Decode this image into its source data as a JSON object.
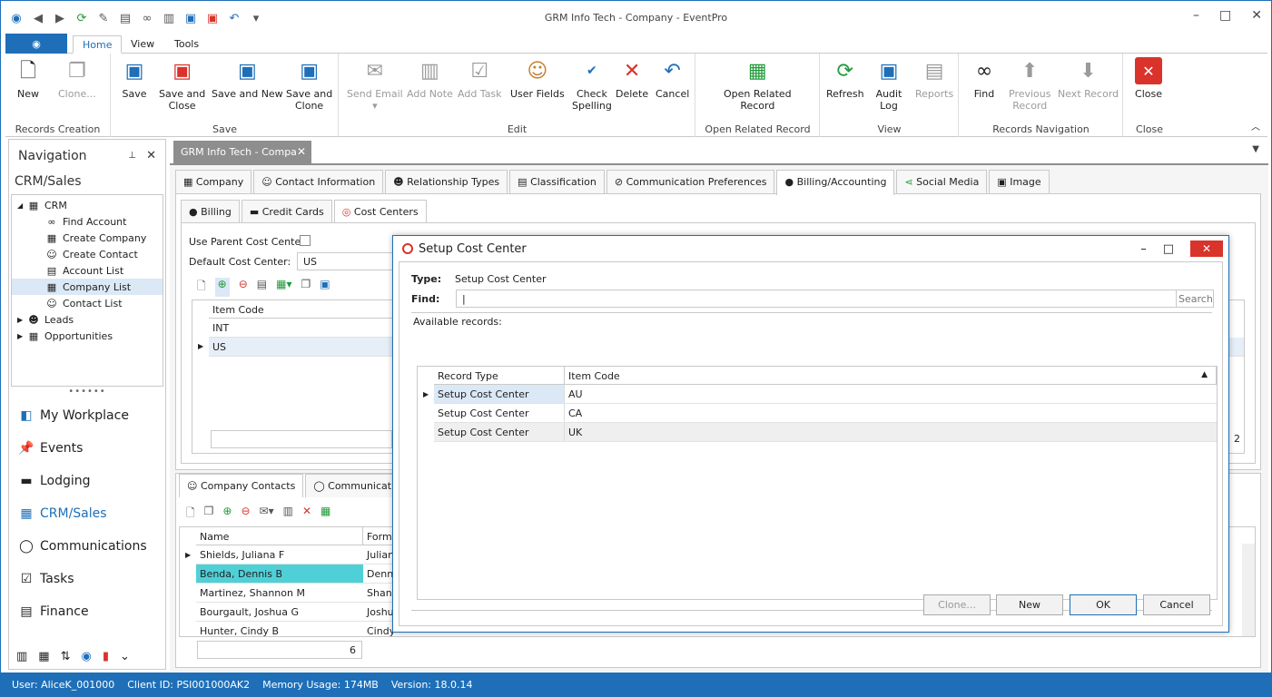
{
  "window": {
    "title": "GRM Info Tech - Company - EventPro"
  },
  "ribbon_tabs": [
    "Home",
    "View",
    "Tools"
  ],
  "ribbon": {
    "records_creation": {
      "label": "Records Creation",
      "new": "New",
      "clone": "Clone..."
    },
    "save": {
      "label": "Save",
      "save": "Save",
      "save_close_1": "Save and",
      "save_close_2": "Close",
      "save_new": "Save and New",
      "save_clone_1": "Save and",
      "save_clone_2": "Clone"
    },
    "edit": {
      "label": "Edit",
      "send_email": "Send Email",
      "add_note": "Add Note",
      "add_task": "Add Task",
      "user_fields": "User Fields",
      "check_1": "Check",
      "check_2": "Spelling",
      "delete": "Delete",
      "cancel": "Cancel"
    },
    "open_related": {
      "label": "Open Related Record",
      "btn_1": "Open Related",
      "btn_2": "Record"
    },
    "view": {
      "label": "View",
      "refresh": "Refresh",
      "audit_1": "Audit",
      "audit_2": "Log",
      "reports": "Reports"
    },
    "nav": {
      "label": "Records Navigation",
      "find": "Find",
      "prev_1": "Previous",
      "prev_2": "Record",
      "next": "Next Record"
    },
    "close": {
      "label": "Close",
      "close": "Close"
    }
  },
  "navigation": {
    "title": "Navigation",
    "section": "CRM/Sales",
    "tree": [
      "CRM",
      "Find Account",
      "Create Company",
      "Create Contact",
      "Account List",
      "Company List",
      "Contact List",
      "Leads",
      "Opportunities"
    ],
    "items": [
      "My Workplace",
      "Events",
      "Lodging",
      "CRM/Sales",
      "Communications",
      "Tasks",
      "Finance"
    ]
  },
  "document_tab": "GRM Info Tech - Compa",
  "tabs1": [
    "Company",
    "Contact Information",
    "Relationship Types",
    "Classification",
    "Communication Preferences",
    "Billing/Accounting",
    "Social Media",
    "Image"
  ],
  "tabs2": [
    "Billing",
    "Credit Cards",
    "Cost Centers"
  ],
  "cost_centers": {
    "use_parent_label": "Use Parent Cost Center",
    "default_label": "Default Cost Center:",
    "default_value": "US",
    "col_item_code": "Item Code",
    "rows": [
      "INT",
      "US"
    ]
  },
  "contacts": {
    "tabs": [
      "Company Contacts",
      "Communications"
    ],
    "cols": [
      "Name",
      "Forma"
    ],
    "rows": [
      [
        "Shields, Juliana F",
        "Juliana"
      ],
      [
        "Benda, Dennis B",
        "Dennis"
      ],
      [
        "Martinez, Shannon M",
        "Shann"
      ],
      [
        "Bourgault, Joshua G",
        "Joshu"
      ],
      [
        "Hunter, Cindy B",
        "Cindy"
      ]
    ],
    "count": "6"
  },
  "dialog": {
    "title": "Setup Cost Center",
    "type_label": "Type:",
    "type_value": "Setup Cost Center",
    "find_label": "Find:",
    "search": "Search",
    "available": "Available records:",
    "cols": [
      "Record Type",
      "Item Code"
    ],
    "rows": [
      [
        "Setup Cost Center",
        "AU"
      ],
      [
        "Setup Cost Center",
        "CA"
      ],
      [
        "Setup Cost Center",
        "UK"
      ]
    ],
    "buttons": {
      "clone": "Clone...",
      "new": "New",
      "ok": "OK",
      "cancel": "Cancel"
    }
  },
  "partial_number": "2",
  "status": {
    "user": "User: AliceK_001000",
    "client": "Client ID: PSI001000AK2",
    "memory": "Memory Usage: 174MB",
    "version": "Version: 18.0.14"
  },
  "colors": {
    "accent": "#1e6fb8",
    "selected_row": "#4fd0d6",
    "close_red": "#d9332b"
  }
}
